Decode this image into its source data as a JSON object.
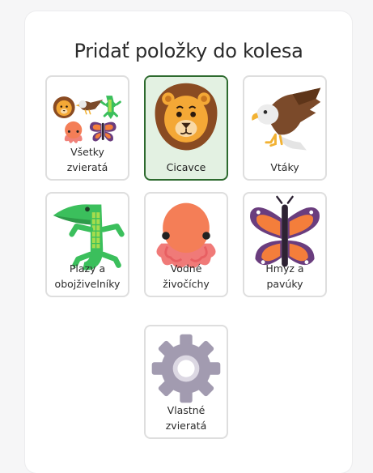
{
  "dialog": {
    "title": "Pridať položky do kolesa"
  },
  "categories": [
    {
      "label": "Všetky zvieratá",
      "icon": "all-animals-icon",
      "selected": false
    },
    {
      "label": "Cicavce",
      "icon": "lion-icon",
      "selected": true
    },
    {
      "label": "Vtáky",
      "icon": "eagle-icon",
      "selected": false
    },
    {
      "label": "Plazy a obojživelníky",
      "icon": "crocodile-icon",
      "selected": false
    },
    {
      "label": "Vodné živočíchy",
      "icon": "octopus-icon",
      "selected": false
    },
    {
      "label": "Hmyz a pavúky",
      "icon": "butterfly-icon",
      "selected": false
    },
    {
      "label": "Vlastné zvieratá",
      "icon": "gear-icon",
      "selected": false
    }
  ],
  "colors": {
    "selected_border": "#2d6a2e",
    "selected_bg": "#e3f1e2",
    "card_border": "#dedede"
  }
}
